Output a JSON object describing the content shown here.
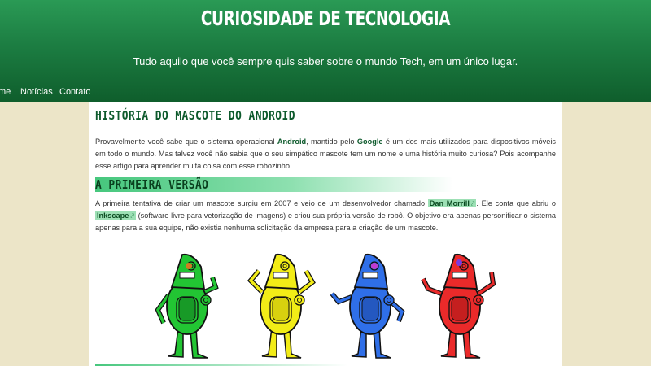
{
  "header": {
    "site_title": "CURIOSIDADE DE TECNOLOGIA",
    "tagline": "Tudo aquilo que você sempre quis saber sobre o mundo Tech, em um único lugar."
  },
  "nav": {
    "items": [
      {
        "label": "me"
      },
      {
        "label": "Notícias"
      },
      {
        "label": "Contato"
      }
    ]
  },
  "article": {
    "title": "História do mascote do Android",
    "intro": {
      "t1": "Provavelmente você sabe que o sistema operacional ",
      "k1": "Android",
      "t2": ", mantido pelo ",
      "k2": "Google",
      "t3": " é um dos mais utilizados para dispositivos móveis em todo o mundo. Mas talvez você não sabia que o seu simpático mascote tem um nome e uma história muito curiosa? Pois acompanhe esse artigo para aprender muita coisa com esse robozinho."
    },
    "section1": {
      "title": "A primeira versão",
      "t1": "A primeira tentativa de criar um mascote surgiu em 2007 e veio de um desenvolvedor chamado ",
      "link1": "Dan Morrill",
      "t2": ". Ele conta que abriu o ",
      "link2": "Inkscape",
      "t3": " (software livre para vetorização de imagens) e criou sua própria versão de robô. O objetivo era apenas personificar o sistema apenas para a sua equipe, não existia nenhuma solicitação da empresa para a criação de um mascote."
    },
    "illustration": {
      "icon": "four-robot-mascots-illustration",
      "colors": [
        "#22c533",
        "#f2ec17",
        "#2f6fe8",
        "#ea2a2a"
      ]
    }
  },
  "colors": {
    "header_green": "#1c7d42",
    "accent_green": "#0d5a2c",
    "page_bg": "#ece5c8"
  }
}
